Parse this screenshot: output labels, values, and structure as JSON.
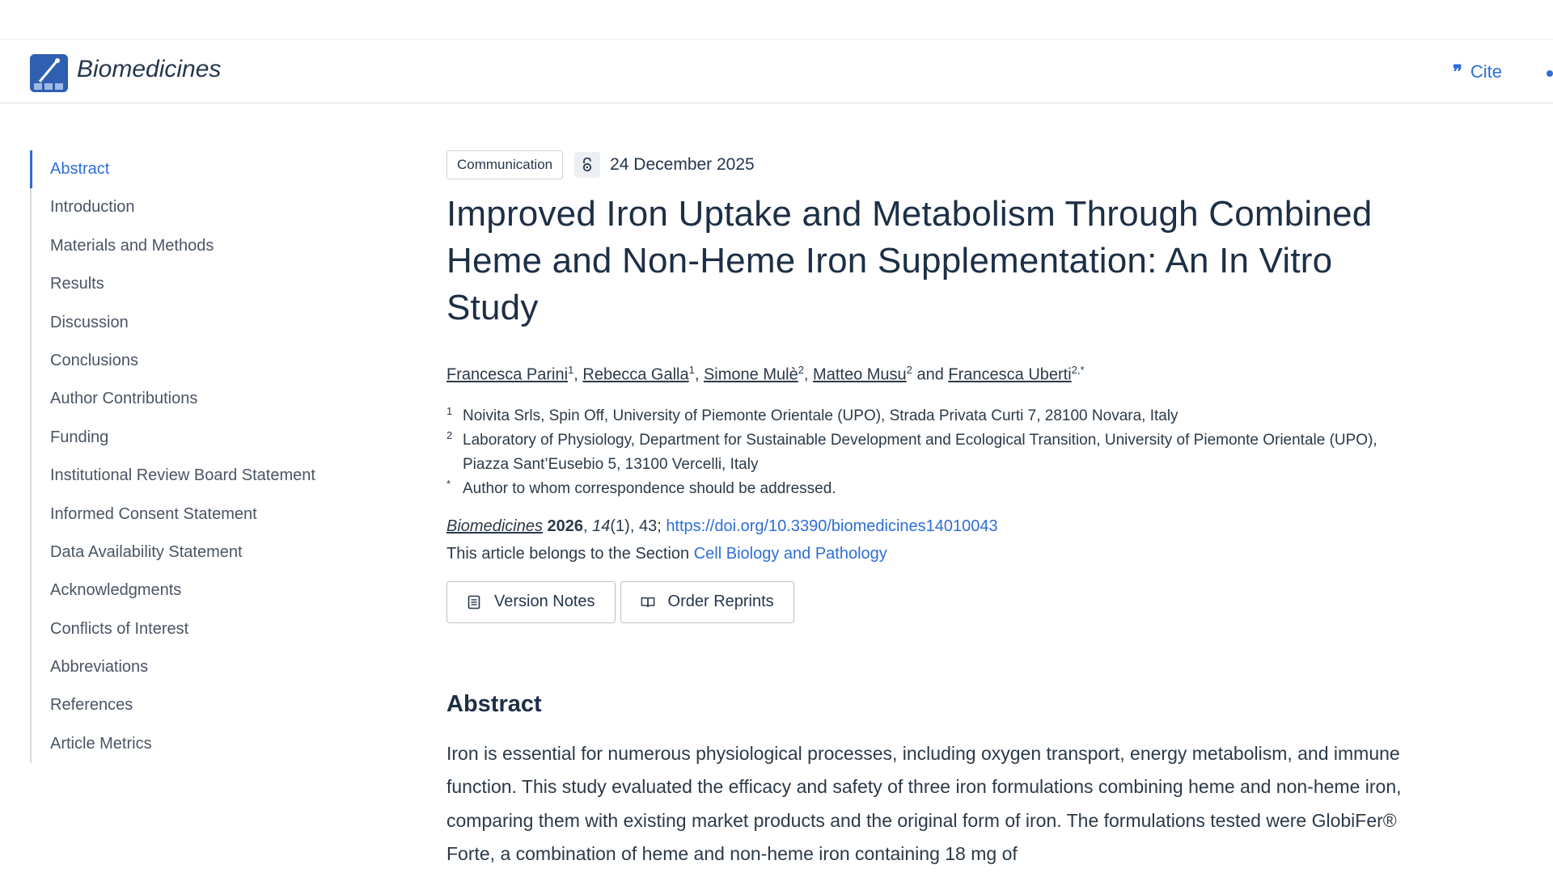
{
  "header": {
    "brand": "Biomedicines",
    "cite_label": "Cite"
  },
  "toc": [
    "Abstract",
    "Introduction",
    "Materials and Methods",
    "Results",
    "Discussion",
    "Conclusions",
    "Author Contributions",
    "Funding",
    "Institutional Review Board Statement",
    "Informed Consent Statement",
    "Data Availability Statement",
    "Acknowledgments",
    "Conflicts of Interest",
    "Abbreviations",
    "References",
    "Article Metrics"
  ],
  "article": {
    "type": "Communication",
    "date": "24 December 2025",
    "title": "Improved Iron Uptake and Metabolism Through Combined Heme and Non-Heme Iron Supplementation: An In Vitro Study",
    "authors": [
      {
        "name": "Francesca Parini",
        "sup": "1"
      },
      {
        "name": "Rebecca Galla",
        "sup": "1"
      },
      {
        "name": "Simone Mulè",
        "sup": "2"
      },
      {
        "name": "Matteo Musu",
        "sup": "2"
      },
      {
        "name": "Francesca Uberti",
        "sup": "2,*"
      }
    ],
    "and_word": "and",
    "affiliations": [
      {
        "num": "1",
        "text": "Noivita Srls, Spin Off, University of Piemonte Orientale (UPO), Strada Privata Curti 7, 28100 Novara, Italy"
      },
      {
        "num": "2",
        "text": "Laboratory of Physiology, Department for Sustainable Development and Ecological Transition, University of Piemonte Orientale (UPO), Piazza Sant’Eusebio 5, 13100 Vercelli, Italy"
      },
      {
        "num": "*",
        "text": "Author to whom correspondence should be addressed."
      }
    ],
    "citation": {
      "journal": "Biomedicines",
      "year": "2026",
      "volume": "14",
      "issue_pages": "(1), 43;",
      "doi": "https://doi.org/10.3390/biomedicines14010043",
      "section_prefix": "This article belongs to the Section",
      "section": "Cell Biology and Pathology"
    },
    "buttons": {
      "version_notes": "Version Notes",
      "order_reprints": "Order Reprints"
    },
    "abstract_heading": "Abstract",
    "abstract_text": "Iron is essential for numerous physiological processes, including oxygen transport, energy metabolism, and immune function. This study evaluated the efficacy and safety of three iron formulations combining heme and non-heme iron, comparing them with existing market products and the original form of iron. The formulations tested were GlobiFer® Forte, a combination of heme and non-heme iron containing 18 mg of"
  },
  "colors": {
    "accent": "#2e6ed6",
    "text": "#2b3a48",
    "title": "#1c2f45"
  }
}
